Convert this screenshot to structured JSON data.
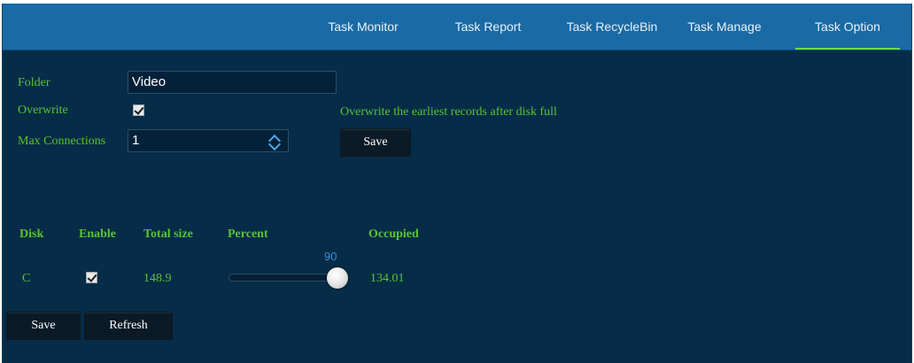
{
  "tabs": [
    {
      "label": "Task Monitor",
      "active": false
    },
    {
      "label": "Task Report",
      "active": false
    },
    {
      "label": "Task RecycleBin",
      "active": false
    },
    {
      "label": "Task Manage",
      "active": false
    },
    {
      "label": "Task Option",
      "active": true
    }
  ],
  "form": {
    "folder_label": "Folder",
    "folder_value": "Video",
    "overwrite_label": "Overwrite",
    "overwrite_checked": true,
    "overwrite_hint": "Overwrite the earliest records after disk full",
    "max_connections_label": "Max Connections",
    "max_connections_value": "1",
    "save_label": "Save"
  },
  "disk_table": {
    "headers": [
      "Disk",
      "Enable",
      "Total size",
      "Percent",
      "Occupied"
    ],
    "rows": [
      {
        "disk": "C",
        "enabled": true,
        "total_size": "148.9",
        "percent": "90",
        "occupied": "134.01"
      }
    ]
  },
  "footer": {
    "save_label": "Save",
    "refresh_label": "Refresh"
  },
  "colors": {
    "background": "#062c47",
    "topbar": "#1a6aa5",
    "label_green": "#59c433",
    "active_tab_underline": "#6ddc4a",
    "slider_value": "#3b8fd4"
  },
  "icons": [
    "checkbox-checked-icon",
    "spinner-up-icon",
    "spinner-down-icon",
    "slider-knob-icon"
  ]
}
